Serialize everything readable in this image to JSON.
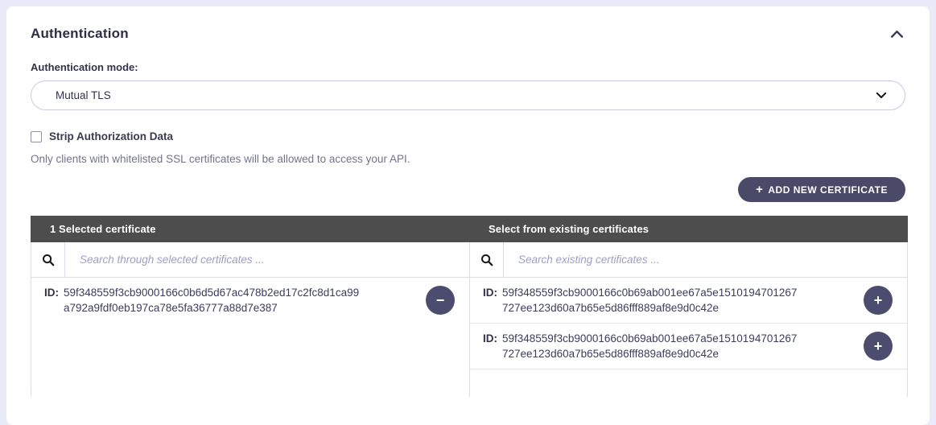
{
  "panel": {
    "title": "Authentication"
  },
  "auth_mode": {
    "label": "Authentication mode:",
    "value": "Mutual TLS"
  },
  "strip_auth": {
    "label": "Strip Authorization Data",
    "checked": false
  },
  "description": "Only clients with whitelisted SSL certificates will be allowed to access your API.",
  "add_button": {
    "plus_glyph": "+",
    "label": "ADD NEW CERTIFICATE"
  },
  "icons": {
    "minus": "−",
    "plus": "+"
  },
  "certificates": {
    "selected": {
      "header": "1 Selected certificate",
      "search_placeholder": "Search through selected certificates ...",
      "rows": [
        {
          "id_label": "ID:",
          "id_line1": "59f348559f3cb9000166c0b6d5d67ac478b2ed17c2fc8d1ca99",
          "id_line2": "a792a9fdf0eb197ca78e5fa36777a88d7e387"
        }
      ]
    },
    "existing": {
      "header": "Select from existing certificates",
      "search_placeholder": "Search existing certificates ...",
      "rows": [
        {
          "id_label": "ID:",
          "id_line1": "59f348559f3cb9000166c0b69ab001ee67a5e1510194701267",
          "id_line2": "727ee123d60a7b65e5d86fff889af8e9d0c42e"
        },
        {
          "id_label": "ID:",
          "id_line1": "59f348559f3cb9000166c0b69ab001ee67a5e1510194701267",
          "id_line2": "727ee123d60a7b65e5d86fff889af8e9d0c42e"
        }
      ]
    }
  },
  "colors": {
    "page_bg": "#e9ebf8",
    "card_bg": "#ffffff",
    "accent_dark": "#4c4c6e",
    "table_header_bg": "#4d4d4d",
    "border": "#dcdcee",
    "text_dark": "#33334d",
    "text_gray": "#73738c",
    "placeholder": "#9e9ec4"
  }
}
